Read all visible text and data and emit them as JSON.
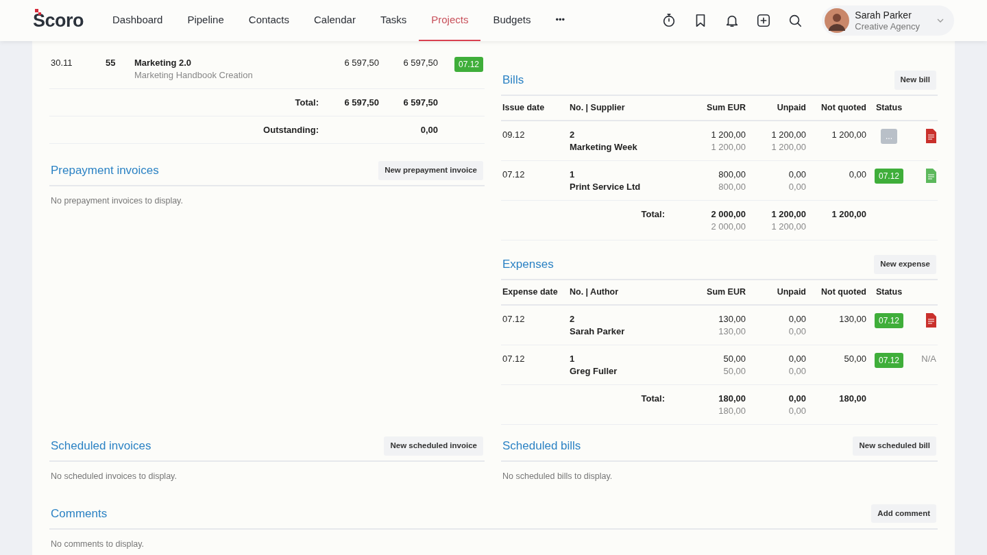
{
  "navbar": {
    "logo": "Scoro",
    "items": [
      {
        "label": "Dashboard",
        "selected": false
      },
      {
        "label": "Pipeline",
        "selected": false
      },
      {
        "label": "Contacts",
        "selected": false
      },
      {
        "label": "Calendar",
        "selected": false
      },
      {
        "label": "Tasks",
        "selected": false
      },
      {
        "label": "Projects",
        "selected": true
      },
      {
        "label": "Budgets",
        "selected": false
      }
    ],
    "more": "•••",
    "user": {
      "name": "Sarah Parker",
      "org": "Creative Agency"
    }
  },
  "invoices": {
    "rows": [
      {
        "date": "30.11",
        "no": "55",
        "payer": "Marketing 2.0",
        "project": "Marketing Handbook Creation",
        "sum": "6 597,50",
        "incl_tax": "6 597,50",
        "status": {
          "kind": "date",
          "text": "07.12"
        }
      }
    ],
    "total": {
      "label": "Total:",
      "sum": "6 597,50",
      "incl_tax": "6 597,50"
    },
    "outstanding": {
      "label": "Outstanding:",
      "value": "0,00"
    }
  },
  "prepayment": {
    "title": "Prepayment invoices",
    "button": "New prepayment invoice",
    "empty": "No prepayment invoices to display."
  },
  "bills": {
    "title": "Bills",
    "button": "New bill",
    "columns": [
      "Issue date",
      "No. | Supplier",
      "Sum EUR",
      "Unpaid",
      "Not quoted",
      "Status"
    ],
    "rows": [
      {
        "date": "09.12",
        "no": "2",
        "name": "Marketing Week",
        "sum": "1 200,00",
        "sum_sub": "1 200,00",
        "unpaid": "1 200,00",
        "unpaid_sub": "1 200,00",
        "not_quoted": "1 200,00",
        "status": {
          "kind": "pending",
          "text": "..."
        },
        "file": {
          "kind": "document",
          "color": "#c9302c"
        }
      },
      {
        "date": "07.12",
        "no": "1",
        "name": "Print Service Ltd",
        "sum": "800,00",
        "sum_sub": "800,00",
        "unpaid": "0,00",
        "unpaid_sub": "0,00",
        "not_quoted": "0,00",
        "status": {
          "kind": "date",
          "text": "07.12"
        },
        "file": {
          "kind": "document",
          "color": "#5cb85c"
        }
      }
    ],
    "total": {
      "label": "Total:",
      "sum": "2 000,00",
      "sum_sub": "2 000,00",
      "unpaid": "1 200,00",
      "unpaid_sub": "1 200,00",
      "not_quoted": "1 200,00"
    }
  },
  "expenses": {
    "title": "Expenses",
    "button": "New expense",
    "columns": [
      "Expense date",
      "No. | Author",
      "Sum EUR",
      "Unpaid",
      "Not quoted",
      "Status"
    ],
    "rows": [
      {
        "date": "07.12",
        "no": "2",
        "name": "Sarah Parker",
        "sum": "130,00",
        "sum_sub": "130,00",
        "unpaid": "0,00",
        "unpaid_sub": "0,00",
        "not_quoted": "130,00",
        "status": {
          "kind": "date",
          "text": "07.12"
        },
        "file": {
          "kind": "document",
          "color": "#c9302c"
        }
      },
      {
        "date": "07.12",
        "no": "1",
        "name": "Greg Fuller",
        "sum": "50,00",
        "sum_sub": "50,00",
        "unpaid": "0,00",
        "unpaid_sub": "0,00",
        "not_quoted": "50,00",
        "status": {
          "kind": "date",
          "text": "07.12"
        },
        "file": {
          "kind": "text",
          "text": "N/A"
        }
      }
    ],
    "total": {
      "label": "Total:",
      "sum": "180,00",
      "sum_sub": "180,00",
      "unpaid": "0,00",
      "unpaid_sub": "0,00",
      "not_quoted": "180,00"
    }
  },
  "scheduled_invoices": {
    "title": "Scheduled invoices",
    "button": "New scheduled invoice",
    "empty": "No scheduled invoices to display."
  },
  "scheduled_bills": {
    "title": "Scheduled bills",
    "button": "New scheduled bill",
    "empty": "No scheduled bills to display."
  },
  "comments": {
    "title": "Comments",
    "button": "Add comment",
    "empty": "No comments to display."
  }
}
